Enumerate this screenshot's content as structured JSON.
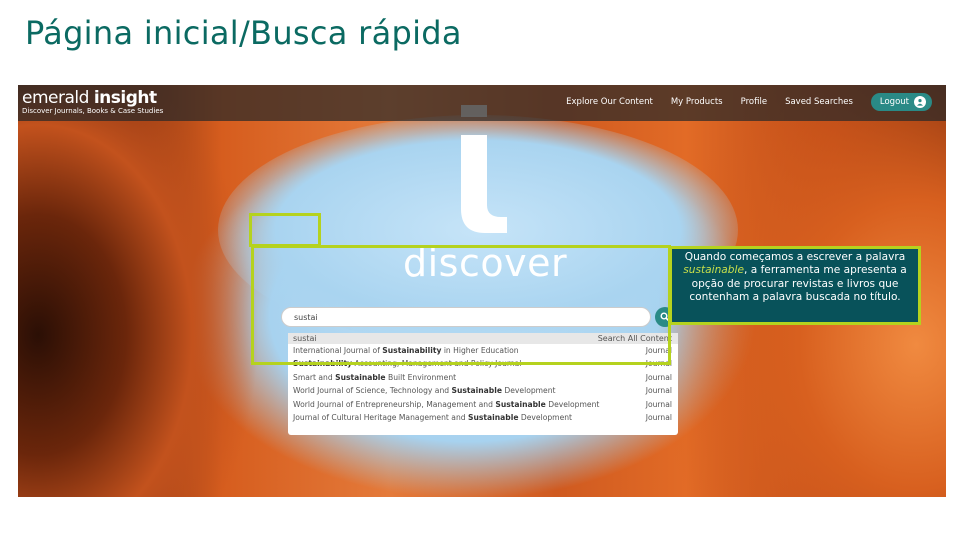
{
  "slide": {
    "title": "Página inicial/Busca rápida"
  },
  "app": {
    "brand_light": "emerald ",
    "brand_bold": "insight",
    "tagline": "Discover Journals, Books & Case Studies",
    "nav": {
      "explore": "Explore Our Content",
      "products": "My Products",
      "profile": "Profile",
      "saved": "Saved Searches",
      "logout": "Logout"
    },
    "hero_word": "discover",
    "search": {
      "value": "sustai"
    },
    "dropdown": {
      "query": "sustai",
      "search_all": "Search All Content",
      "rows": [
        {
          "pre": "International Journal of ",
          "bold": "Sustainability",
          "post": " in Higher Education",
          "type": "Journal"
        },
        {
          "pre": "",
          "bold": "Sustainability",
          "post": " Accounting, Management and Policy Journal",
          "type": "Journal"
        },
        {
          "pre": "Smart and ",
          "bold": "Sustainable",
          "post": " Built Environment",
          "type": "Journal"
        },
        {
          "pre": "World Journal of Science, Technology and ",
          "bold": "Sustainable",
          "post": " Development",
          "type": "Journal"
        },
        {
          "pre": "World Journal of Entrepreneurship, Management and ",
          "bold": "Sustainable",
          "post": " Development",
          "type": "Journal"
        },
        {
          "pre": "Journal of Cultural Heritage Management and ",
          "bold": "Sustainable",
          "post": " Development",
          "type": "Journal"
        }
      ]
    }
  },
  "callout": {
    "line_prefix": "Quando começamos a escrever a palavra ",
    "keyword": "sustainable",
    "line_suffix": ", a ferramenta me apresenta a opção de procurar revistas e livros que contenham a palavra buscada no título."
  },
  "colors": {
    "accent_teal": "#2a8a86",
    "highlight": "#b5d21e",
    "title_teal": "#0b6a62",
    "callout_bg": "#08525a"
  }
}
